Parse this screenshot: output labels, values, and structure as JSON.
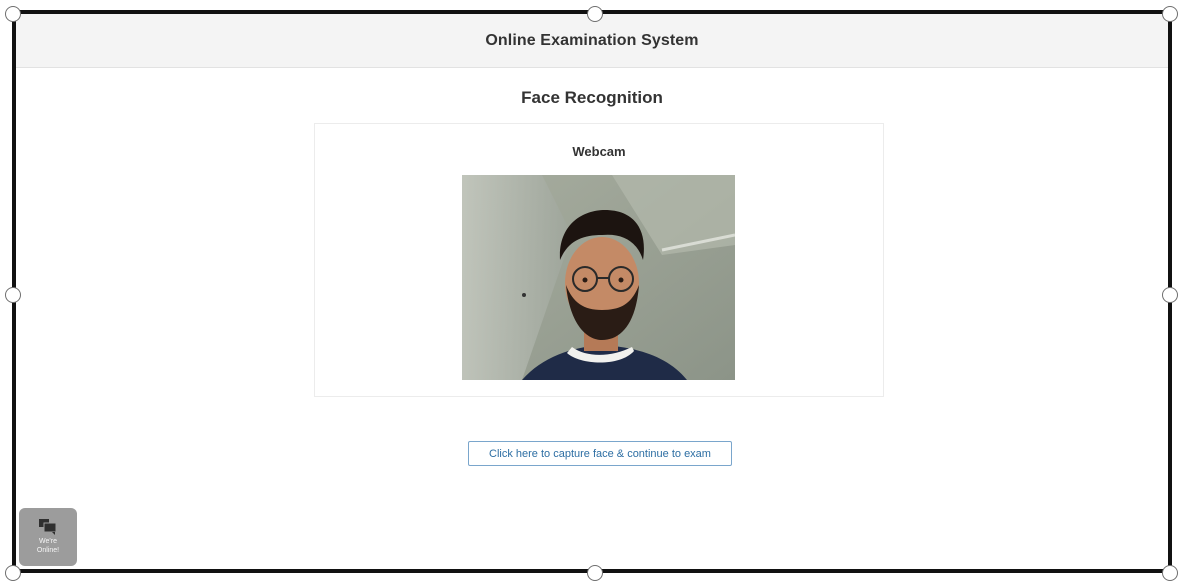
{
  "header": {
    "title": "Online Examination System"
  },
  "main": {
    "title": "Face Recognition",
    "webcam": {
      "label": "Webcam"
    },
    "capture_button": "Click here to capture face & continue to exam"
  },
  "chat_widget": {
    "line1": "We're",
    "line2": "Online!",
    "icon": "chat-bubbles-icon"
  }
}
